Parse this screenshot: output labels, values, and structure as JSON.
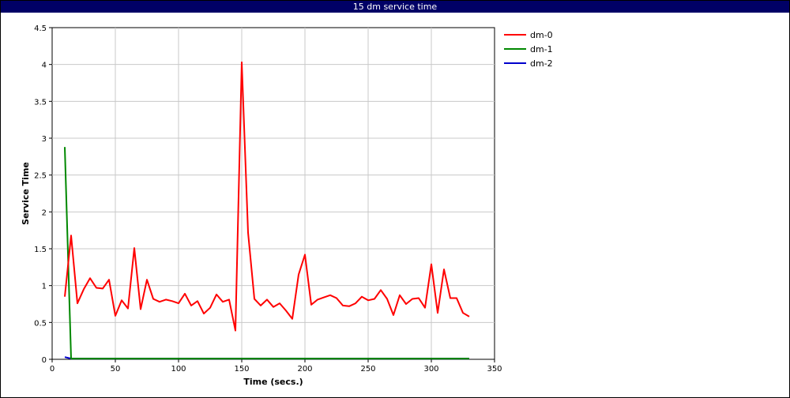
{
  "title": "15 dm service time",
  "chart_data": {
    "type": "line",
    "title": "15 dm service time",
    "xlabel": "Time (secs.)",
    "ylabel": "Service Time",
    "xlim": [
      0,
      350
    ],
    "ylim": [
      0,
      4.5
    ],
    "xticks": [
      0,
      50,
      100,
      150,
      200,
      250,
      300,
      350
    ],
    "yticks": [
      0,
      0.5,
      1,
      1.5,
      2,
      2.5,
      3,
      3.5,
      4,
      4.5
    ],
    "grid": true,
    "legend_position": "right",
    "series": [
      {
        "name": "dm-0",
        "color": "#ff0000",
        "x": [
          10,
          15,
          20,
          25,
          30,
          35,
          40,
          45,
          50,
          55,
          60,
          65,
          70,
          75,
          80,
          85,
          90,
          95,
          100,
          105,
          110,
          115,
          120,
          125,
          130,
          135,
          140,
          145,
          150,
          155,
          160,
          165,
          170,
          175,
          180,
          185,
          190,
          195,
          200,
          205,
          210,
          215,
          220,
          225,
          230,
          235,
          240,
          245,
          250,
          255,
          260,
          265,
          270,
          275,
          280,
          285,
          290,
          295,
          300,
          305,
          310,
          315,
          320,
          325,
          330
        ],
        "y": [
          0.85,
          1.68,
          0.76,
          0.95,
          1.1,
          0.97,
          0.96,
          1.08,
          0.59,
          0.8,
          0.69,
          1.51,
          0.68,
          1.08,
          0.82,
          0.78,
          0.81,
          0.79,
          0.76,
          0.89,
          0.73,
          0.79,
          0.62,
          0.7,
          0.88,
          0.78,
          0.81,
          0.39,
          4.03,
          1.72,
          0.82,
          0.73,
          0.81,
          0.71,
          0.76,
          0.66,
          0.55,
          1.15,
          1.42,
          0.74,
          0.81,
          0.84,
          0.87,
          0.83,
          0.73,
          0.72,
          0.76,
          0.85,
          0.8,
          0.82,
          0.94,
          0.82,
          0.6,
          0.87,
          0.75,
          0.82,
          0.83,
          0.7,
          1.29,
          0.63,
          1.22,
          0.83,
          0.83,
          0.63,
          0.58
        ]
      },
      {
        "name": "dm-1",
        "color": "#008800",
        "x": [
          10,
          15,
          20,
          330
        ],
        "y": [
          2.88,
          0.01,
          0.01,
          0.01
        ]
      },
      {
        "name": "dm-2",
        "color": "#0000cc",
        "x": [
          10,
          15,
          20,
          330
        ],
        "y": [
          0.03,
          0.01,
          0.01,
          0.01
        ]
      }
    ]
  }
}
